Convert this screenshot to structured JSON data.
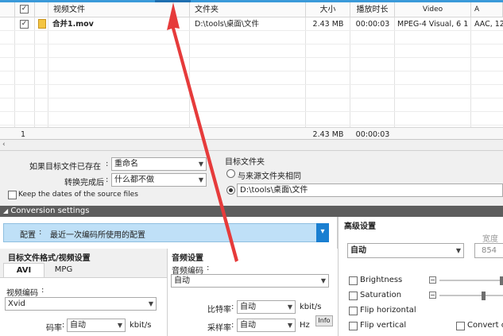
{
  "table": {
    "headers": {
      "video_file": "视频文件",
      "folder": "文件夹",
      "size": "大小",
      "duration": "播放时长",
      "video": "Video",
      "audio": "A"
    },
    "rows": [
      {
        "name": "合并1.mov",
        "folder": "D:\\tools\\桌面\\文件",
        "size": "2.43 MB",
        "duration": "00:00:03",
        "video": "MPEG-4 Visual, 6 1...",
        "audio": "AAC, 12..."
      }
    ],
    "footer": {
      "count": "1",
      "size": "2.43 MB",
      "duration": "00:00:03"
    }
  },
  "options": {
    "if_exists_label": "如果目标文件已存在",
    "if_exists_value": "重命名",
    "after_convert_label": "转换完成后",
    "after_convert_value": "什么都不做",
    "keep_dates_label": "Keep the dates of the source files",
    "target_folder_label": "目标文件夹",
    "same_as_source_label": "与来源文件夹相同",
    "target_path": "D:\\tools\\桌面\\文件"
  },
  "conversion": {
    "bar_label": "Conversion settings",
    "profile_label": "配置",
    "profile_value": "最近一次编码所使用的配置"
  },
  "video_settings": {
    "title": "目标文件格式/视频设置",
    "tab_avi": "AVI",
    "tab_mpg": "MPG",
    "codec_label": "视频编码",
    "codec_value": "Xvid",
    "bitrate_label": "码率",
    "bitrate_value": "自动",
    "bitrate_unit": "kbit/s"
  },
  "audio_settings": {
    "title": "音频设置",
    "codec_label": "音频编码",
    "codec_value": "自动",
    "bitrate_label": "比特率",
    "bitrate_value": "自动",
    "bitrate_unit": "kbit/s",
    "samplerate_label": "采样率",
    "samplerate_value": "自动",
    "samplerate_unit": "Hz",
    "info_button": "Info"
  },
  "advanced": {
    "title": "高级设置",
    "mode_value": "自动",
    "width_label": "宽度",
    "width_value": "854",
    "brightness_label": "Brightness",
    "saturation_label": "Saturation",
    "flip_h_label": "Flip horizontal",
    "flip_v_label": "Flip vertical",
    "convert_label": "Convert co",
    "saturation_level": 0.7,
    "brightness_level": 1.0
  },
  "colors": {
    "accent": "#1a7fd1",
    "profile_bg": "#bfe0f7",
    "annotation": "#e63b3b",
    "conv_bar": "#5d5d5d"
  }
}
